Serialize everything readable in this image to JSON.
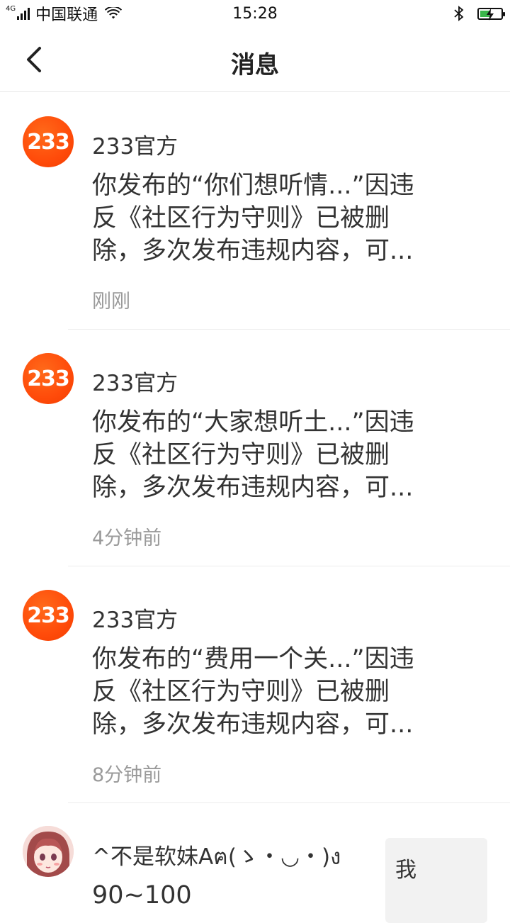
{
  "status_bar": {
    "network": "4G",
    "carrier": "中国联通",
    "time": "15:28",
    "icons": [
      "signal-icon",
      "wifi-icon",
      "bluetooth-icon",
      "battery-charging-icon"
    ]
  },
  "header": {
    "title": "消息",
    "back_icon": "chevron-left-icon"
  },
  "messages": [
    {
      "sender": "233官方",
      "avatar_text": "233",
      "body": "你发布的“你们想听情...”因违\n反《社区行为守则》已被删\n除，多次发布违规内容，可...",
      "time": "刚刚"
    },
    {
      "sender": "233官方",
      "avatar_text": "233",
      "body": "你发布的“大家想听土...”因违\n反《社区行为守则》已被删\n除，多次发布违规内容，可...",
      "time": "4分钟前"
    },
    {
      "sender": "233官方",
      "avatar_text": "233",
      "body": "你发布的“费用一个关...”因违\n反《社区行为守则》已被删\n除，多次发布违规内容，可...",
      "time": "8分钟前"
    }
  ],
  "last_message": {
    "sender": "^不是软妹Aฅ(ゝ・◡・)ง",
    "body": "90~100",
    "thumb_text": "我"
  },
  "colors": {
    "accent_orange": "#ff4b0a",
    "divider": "#ececec",
    "time_gray": "#9a9a9a",
    "battery_green": "#3ab54a"
  }
}
